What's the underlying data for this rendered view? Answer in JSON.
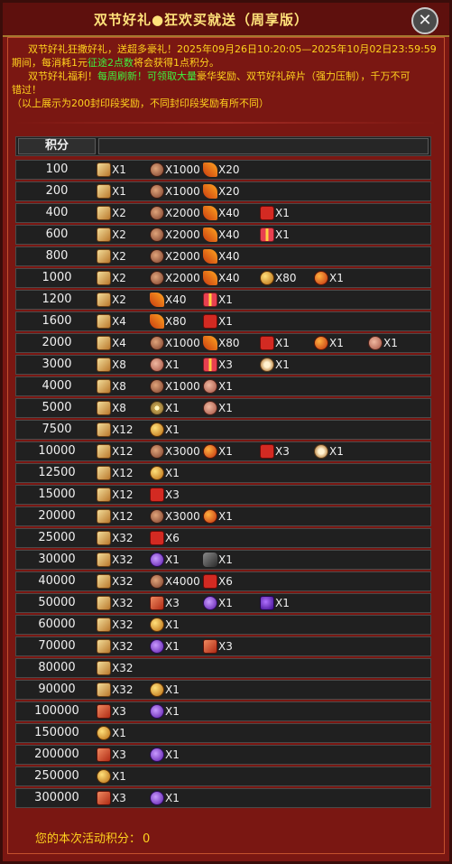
{
  "title": "双节好礼●狂欢买就送（周享版）",
  "close_icon": "close-icon",
  "desc": {
    "line1": "双节好礼狂撒好礼，送超多豪礼！2025年09月26日10:20:05—2025年10月02日23:59:59",
    "line2_a": "期间，每消耗1元",
    "line2_b": "征途2点数",
    "line2_c": "将会获得1点积分。",
    "line3_a": "双节好礼福利！",
    "line3_b": "每周刷新！可领取大量",
    "line3_c": "豪华奖励、双节好礼碎片（强力压制），千万不可",
    "line4": "错过！",
    "line5": "（以上展示为200封印段奖励，不同封印段奖励有所不同）"
  },
  "table": {
    "header_score": "积分",
    "rows": [
      {
        "score": "100",
        "items": [
          {
            "icon": "scroll",
            "qty": "X1"
          },
          {
            "icon": "coin",
            "qty": "X1000"
          },
          {
            "icon": "feather",
            "qty": "X20"
          }
        ]
      },
      {
        "score": "200",
        "items": [
          {
            "icon": "scroll",
            "qty": "X1"
          },
          {
            "icon": "coin",
            "qty": "X1000"
          },
          {
            "icon": "feather",
            "qty": "X20"
          }
        ]
      },
      {
        "score": "400",
        "items": [
          {
            "icon": "scroll",
            "qty": "X2"
          },
          {
            "icon": "coin",
            "qty": "X2000"
          },
          {
            "icon": "feather",
            "qty": "X40"
          },
          {
            "icon": "redbox",
            "qty": "X1"
          }
        ]
      },
      {
        "score": "600",
        "items": [
          {
            "icon": "scroll",
            "qty": "X2"
          },
          {
            "icon": "coin",
            "qty": "X2000"
          },
          {
            "icon": "feather",
            "qty": "X40"
          },
          {
            "icon": "giftbox",
            "qty": "X1"
          }
        ]
      },
      {
        "score": "800",
        "items": [
          {
            "icon": "scroll",
            "qty": "X2"
          },
          {
            "icon": "coin",
            "qty": "X2000"
          },
          {
            "icon": "feather",
            "qty": "X40"
          }
        ]
      },
      {
        "score": "1000",
        "items": [
          {
            "icon": "scroll",
            "qty": "X2"
          },
          {
            "icon": "coin",
            "qty": "X2000"
          },
          {
            "icon": "feather",
            "qty": "X40"
          },
          {
            "icon": "goldorb",
            "qty": "X80"
          },
          {
            "icon": "fireorb",
            "qty": "X1"
          }
        ]
      },
      {
        "score": "1200",
        "items": [
          {
            "icon": "scroll",
            "qty": "X2"
          },
          {
            "icon": "feather",
            "qty": "X40"
          },
          {
            "icon": "giftbox",
            "qty": "X1"
          }
        ]
      },
      {
        "score": "1600",
        "items": [
          {
            "icon": "scroll",
            "qty": "X4"
          },
          {
            "icon": "feather",
            "qty": "X80"
          },
          {
            "icon": "redbox",
            "qty": "X1"
          }
        ]
      },
      {
        "score": "2000",
        "items": [
          {
            "icon": "scroll",
            "qty": "X4"
          },
          {
            "icon": "coin",
            "qty": "X1000"
          },
          {
            "icon": "feather",
            "qty": "X80"
          },
          {
            "icon": "redbox",
            "qty": "X1"
          },
          {
            "icon": "fireorb",
            "qty": "X1"
          },
          {
            "icon": "rosecoin",
            "qty": "X1"
          }
        ]
      },
      {
        "score": "3000",
        "items": [
          {
            "icon": "scroll",
            "qty": "X8"
          },
          {
            "icon": "rosecoin",
            "qty": "X1"
          },
          {
            "icon": "giftbox",
            "qty": "X3"
          },
          {
            "icon": "beigeflower",
            "qty": "X1"
          }
        ]
      },
      {
        "score": "4000",
        "items": [
          {
            "icon": "scroll",
            "qty": "X8"
          },
          {
            "icon": "coin",
            "qty": "X1000"
          },
          {
            "icon": "rosecoin",
            "qty": "X1"
          }
        ]
      },
      {
        "score": "5000",
        "items": [
          {
            "icon": "scroll",
            "qty": "X8"
          },
          {
            "icon": "sunwheel",
            "qty": "X1"
          },
          {
            "icon": "rosecoin",
            "qty": "X1"
          }
        ]
      },
      {
        "score": "7500",
        "items": [
          {
            "icon": "scroll",
            "qty": "X12"
          },
          {
            "icon": "goldorb",
            "qty": "X1"
          }
        ]
      },
      {
        "score": "10000",
        "items": [
          {
            "icon": "scroll",
            "qty": "X12"
          },
          {
            "icon": "coin",
            "qty": "X3000"
          },
          {
            "icon": "fireorb",
            "qty": "X1"
          },
          {
            "icon": "redbox",
            "qty": "X3"
          },
          {
            "icon": "beigeflower",
            "qty": "X1"
          }
        ]
      },
      {
        "score": "12500",
        "items": [
          {
            "icon": "scroll",
            "qty": "X12"
          },
          {
            "icon": "goldorb",
            "qty": "X1"
          }
        ]
      },
      {
        "score": "15000",
        "items": [
          {
            "icon": "scroll",
            "qty": "X12"
          },
          {
            "icon": "redbox",
            "qty": "X3"
          }
        ]
      },
      {
        "score": "20000",
        "items": [
          {
            "icon": "scroll",
            "qty": "X12"
          },
          {
            "icon": "coin",
            "qty": "X3000"
          },
          {
            "icon": "fireorb",
            "qty": "X1"
          }
        ]
      },
      {
        "score": "25000",
        "items": [
          {
            "icon": "scroll",
            "qty": "X32"
          },
          {
            "icon": "redbox",
            "qty": "X6"
          }
        ]
      },
      {
        "score": "30000",
        "items": [
          {
            "icon": "scroll",
            "qty": "X32"
          },
          {
            "icon": "violetorb",
            "qty": "X1"
          },
          {
            "icon": "darkgear",
            "qty": "X1"
          }
        ]
      },
      {
        "score": "40000",
        "items": [
          {
            "icon": "scroll",
            "qty": "X32"
          },
          {
            "icon": "coin",
            "qty": "X4000"
          },
          {
            "icon": "redbox",
            "qty": "X6"
          }
        ]
      },
      {
        "score": "50000",
        "items": [
          {
            "icon": "scroll",
            "qty": "X32"
          },
          {
            "icon": "redscroll",
            "qty": "X3"
          },
          {
            "icon": "violetorb",
            "qty": "X1"
          },
          {
            "icon": "purpleegg",
            "qty": "X1"
          }
        ]
      },
      {
        "score": "60000",
        "items": [
          {
            "icon": "scroll",
            "qty": "X32"
          },
          {
            "icon": "goldorb",
            "qty": "X1"
          }
        ]
      },
      {
        "score": "70000",
        "items": [
          {
            "icon": "scroll",
            "qty": "X32"
          },
          {
            "icon": "violetorb",
            "qty": "X1"
          },
          {
            "icon": "redscroll",
            "qty": "X3"
          }
        ]
      },
      {
        "score": "80000",
        "items": [
          {
            "icon": "scroll",
            "qty": "X32"
          }
        ]
      },
      {
        "score": "90000",
        "items": [
          {
            "icon": "scroll",
            "qty": "X32"
          },
          {
            "icon": "goldorb",
            "qty": "X1"
          }
        ]
      },
      {
        "score": "100000",
        "items": [
          {
            "icon": "redscroll",
            "qty": "X3"
          },
          {
            "icon": "violetorb",
            "qty": "X1"
          }
        ]
      },
      {
        "score": "150000",
        "items": [
          {
            "icon": "goldorb",
            "qty": "X1"
          }
        ]
      },
      {
        "score": "200000",
        "items": [
          {
            "icon": "redscroll",
            "qty": "X3"
          },
          {
            "icon": "violetorb",
            "qty": "X1"
          }
        ]
      },
      {
        "score": "250000",
        "items": [
          {
            "icon": "goldorb",
            "qty": "X1"
          }
        ]
      },
      {
        "score": "300000",
        "items": [
          {
            "icon": "redscroll",
            "qty": "X3"
          },
          {
            "icon": "violetorb",
            "qty": "X1"
          }
        ]
      }
    ]
  },
  "footer": {
    "label": "您的本次活动积分：",
    "value": "0"
  }
}
